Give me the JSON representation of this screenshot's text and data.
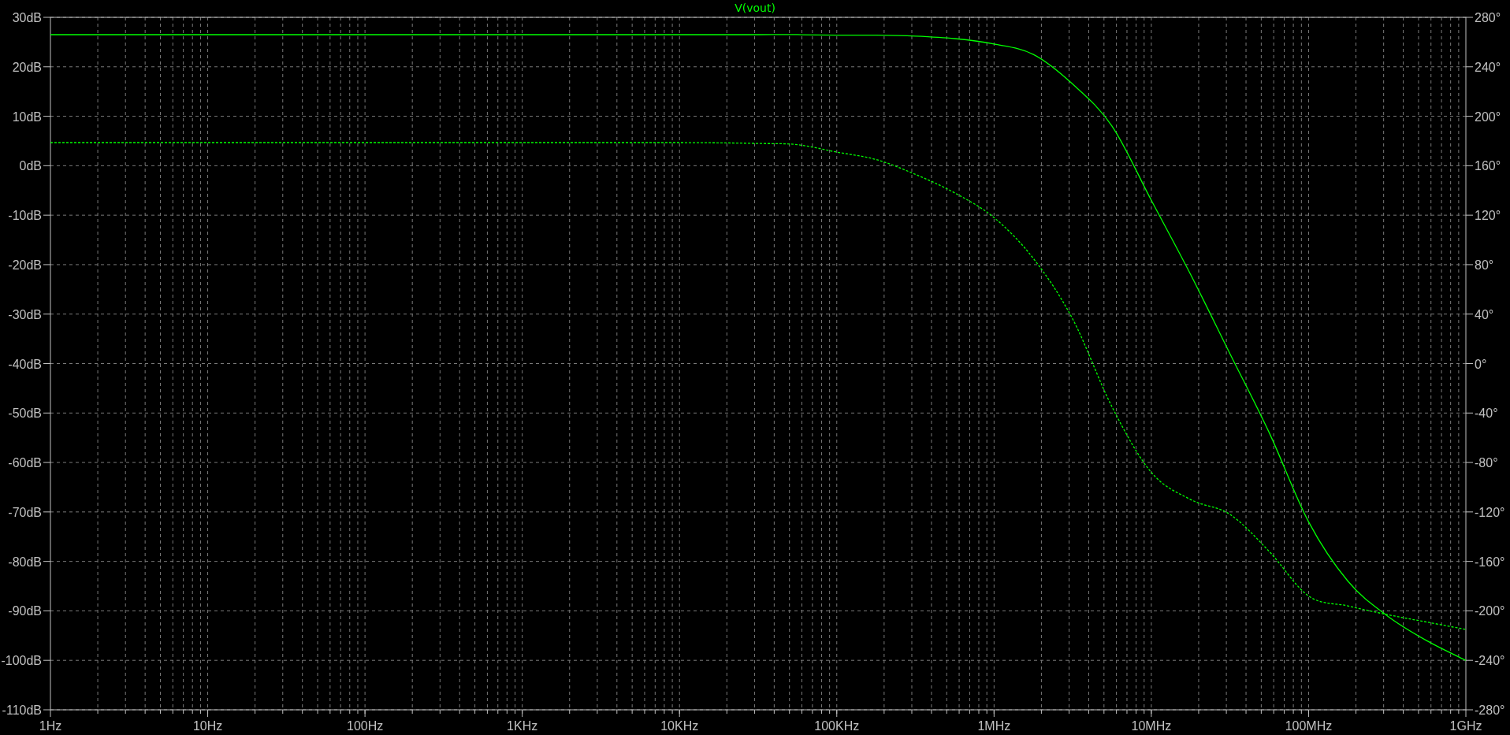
{
  "chart_data": {
    "type": "line",
    "grid": true,
    "ylim": [
      -110,
      30
    ],
    "y2lim": [
      -280,
      280
    ],
    "categories": [
      "1Hz",
      null,
      null,
      null,
      "10Hz",
      null,
      null,
      null,
      "100Hz",
      null,
      null,
      null,
      "1KHz",
      null,
      null,
      null,
      "10KHz",
      null,
      null,
      null,
      "100KHz",
      null,
      null,
      null,
      "1MHz",
      null,
      null,
      null,
      "10MHz",
      null,
      null,
      null,
      "100MHz",
      null,
      null,
      null,
      "1GHz"
    ],
    "series": [
      {
        "name": "V(vout)",
        "axis": "y",
        "line_style": "solid",
        "color": "#00ff00",
        "values": [
          26.5,
          26.5,
          26.5,
          26.5,
          26.5,
          26.5,
          26.5,
          26.5,
          26.5,
          26.5,
          26.5,
          26.5,
          26.5,
          26.5,
          26.5,
          26.5,
          26.5,
          26.5,
          26.5,
          26.5,
          26.4,
          26.4,
          26.2,
          25.7,
          24.6,
          22.5,
          16.5,
          8,
          -7,
          -22,
          -38,
          -54,
          -72,
          -84,
          -91,
          -96,
          -100
        ]
      },
      {
        "axis": "y2",
        "line_style": "dashed",
        "color": "#00ff00",
        "values": [
          178.7,
          178.7,
          178.7,
          178.7,
          178.7,
          178.7,
          178.7,
          178.7,
          178.7,
          178.7,
          178.7,
          178.7,
          178.7,
          178.7,
          178.7,
          178.7,
          178.7,
          178.5,
          178,
          177,
          171,
          165,
          153,
          138,
          118,
          85,
          36,
          -35,
          -88,
          -110,
          -122,
          -152,
          -188,
          -196,
          -203,
          -209,
          -215
        ]
      }
    ],
    "yticks": [
      {
        "value": 30,
        "label": "30dB"
      },
      {
        "value": 20,
        "label": "20dB"
      },
      {
        "value": 10,
        "label": "10dB"
      },
      {
        "value": 0,
        "label": "0dB"
      },
      {
        "value": -10,
        "label": "-10dB"
      },
      {
        "value": -20,
        "label": "-20dB"
      },
      {
        "value": -30,
        "label": "-30dB"
      },
      {
        "value": -40,
        "label": "-40dB"
      },
      {
        "value": -50,
        "label": "-50dB"
      },
      {
        "value": -60,
        "label": "-60dB"
      },
      {
        "value": -70,
        "label": "-70dB"
      },
      {
        "value": -80,
        "label": "-80dB"
      },
      {
        "value": -90,
        "label": "-90dB"
      },
      {
        "value": -100,
        "label": "-100dB"
      },
      {
        "value": -110,
        "label": "-110dB"
      }
    ],
    "y2ticks": [
      {
        "value": 280,
        "label": "280°"
      },
      {
        "value": 240,
        "label": "240°"
      },
      {
        "value": 200,
        "label": "200°"
      },
      {
        "value": 160,
        "label": "160°"
      },
      {
        "value": 120,
        "label": "120°"
      },
      {
        "value": 80,
        "label": "80°"
      },
      {
        "value": 40,
        "label": "40°"
      },
      {
        "value": 0,
        "label": "0°"
      },
      {
        "value": -40,
        "label": "-40°"
      },
      {
        "value": -80,
        "label": "-80°"
      },
      {
        "value": -120,
        "label": "-120°"
      },
      {
        "value": -160,
        "label": "-160°"
      },
      {
        "value": -200,
        "label": "-200°"
      },
      {
        "value": -240,
        "label": "-240°"
      },
      {
        "value": -280,
        "label": "-280°"
      }
    ]
  }
}
